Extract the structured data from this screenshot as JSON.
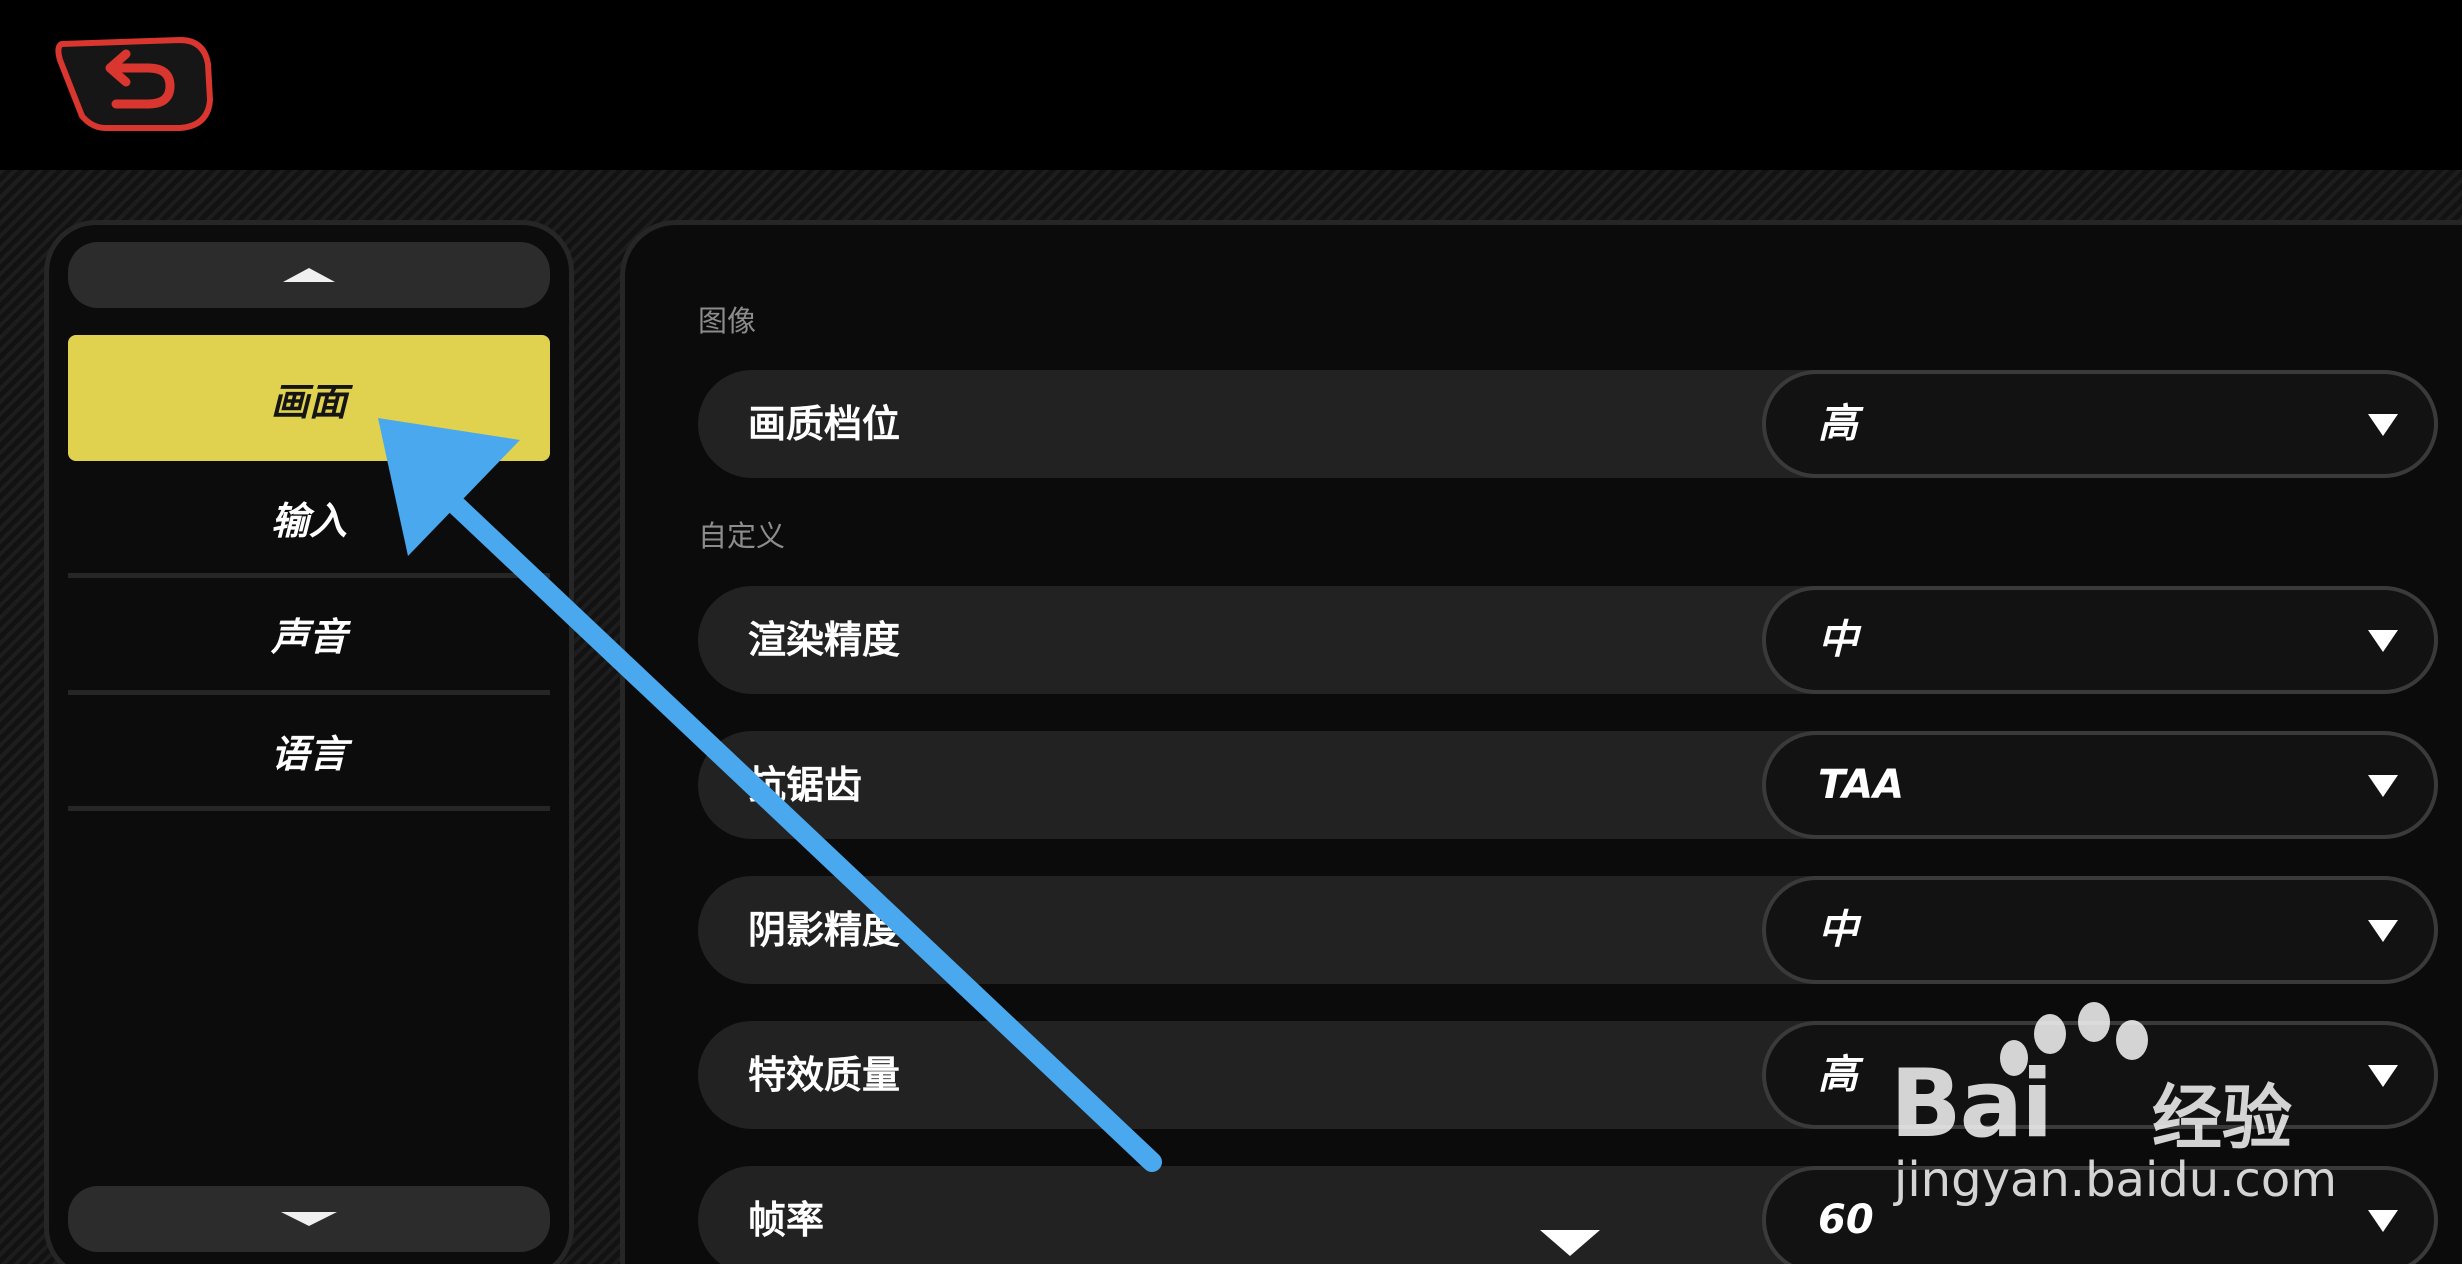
{
  "sidebar": {
    "items": [
      {
        "label": "画面",
        "active": true
      },
      {
        "label": "输入",
        "active": false
      },
      {
        "label": "声音",
        "active": false
      },
      {
        "label": "语言",
        "active": false
      }
    ]
  },
  "sections": {
    "image": "图像",
    "custom": "自定义"
  },
  "settings": [
    {
      "label": "画质档位",
      "value": "高"
    },
    {
      "label": "渲染精度",
      "value": "中"
    },
    {
      "label": "抗锯齿",
      "value": "TAA"
    },
    {
      "label": "阴影精度",
      "value": "中"
    },
    {
      "label": "特效质量",
      "value": "高"
    },
    {
      "label": "帧率",
      "value": "60"
    }
  ],
  "watermark": {
    "brand_prefix": "Bai",
    "brand_suffix": "经验",
    "url": "jingyan.baidu.com"
  },
  "colors": {
    "accent": "#e0d24e",
    "back_button": "#d8362e",
    "annotation_arrow": "#4aa8ef"
  },
  "icons": {
    "back": "back-arrow-icon",
    "scroll_up": "triangle-up-icon",
    "scroll_down": "triangle-down-icon",
    "dropdown": "dropdown-arrow-icon"
  }
}
